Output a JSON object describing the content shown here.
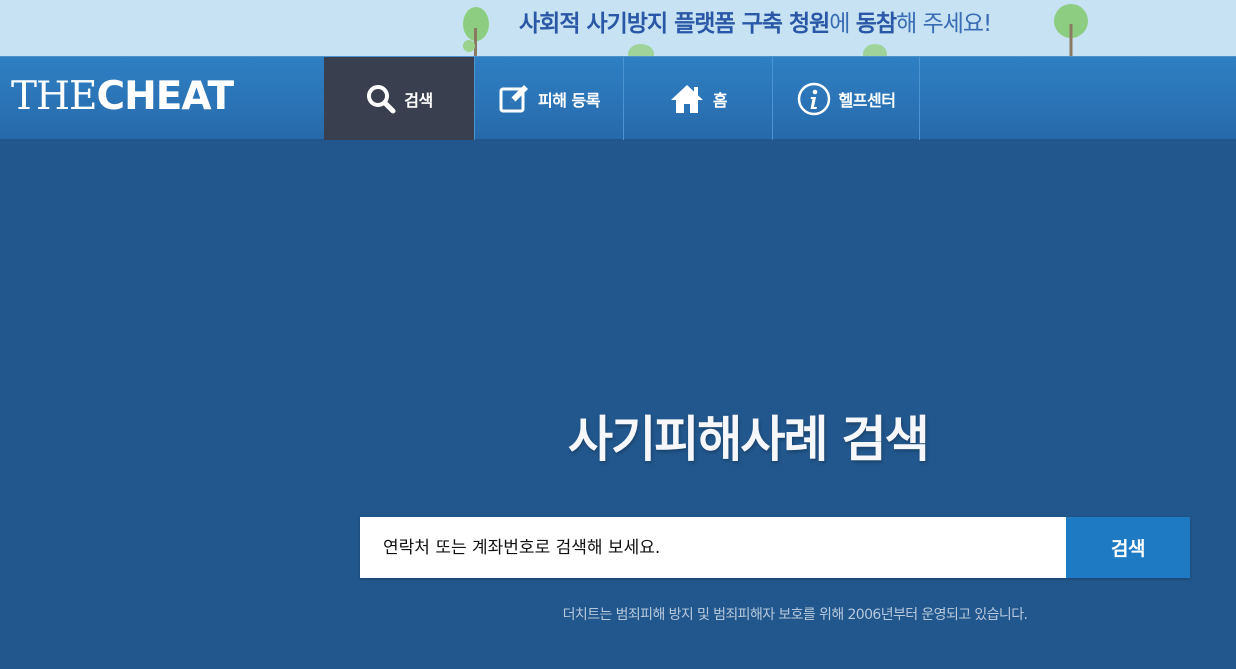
{
  "banner": {
    "part1": "사회적 사기방지 플랫폼 구축 청원",
    "part2": "에 ",
    "part3": "동참",
    "part4": "해 주세요!"
  },
  "header": {
    "logo_thin": "THE",
    "logo_bold": "CHEAT"
  },
  "nav": {
    "items": [
      {
        "label": "검색",
        "icon": "search-icon"
      },
      {
        "label": "피해 등록",
        "icon": "edit-icon"
      },
      {
        "label": "홈",
        "icon": "home-icon"
      },
      {
        "label": "헬프센터",
        "icon": "info-icon"
      }
    ]
  },
  "hero": {
    "title": "사기피해사례 검색",
    "search_placeholder": "연락처 또는 계좌번호로 검색해 보세요.",
    "search_value": "",
    "search_button": "검색",
    "tagline": "더치트는 범죄피해 방지 및 범죄피해자 보호를 위해 2006년부터 운영되고 있습니다."
  },
  "colors": {
    "banner_bg": "#c7e3f3",
    "banner_text": "#2b5fae",
    "navbar_bg": "#2a73b5",
    "nav_active_bg": "#3a3f4f",
    "page_bg": "#22578d",
    "search_button_bg": "#1e7ac2"
  }
}
